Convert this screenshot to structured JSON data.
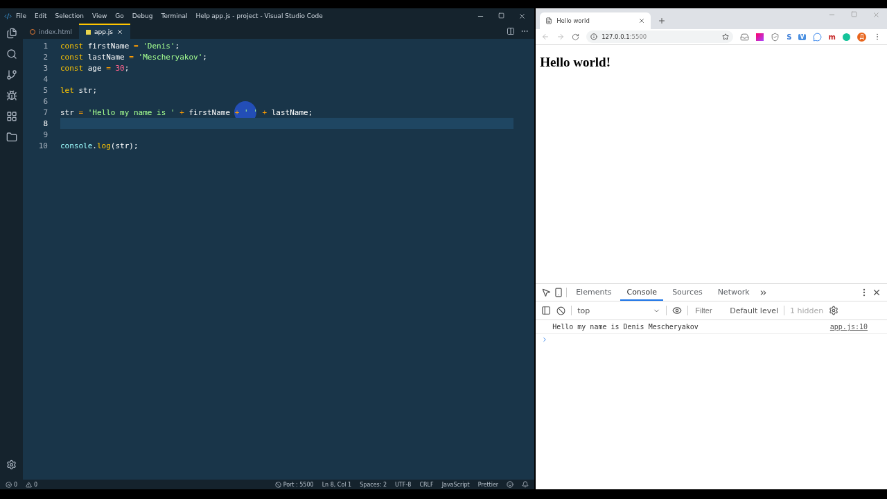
{
  "editor": {
    "window_title": "app.js - project - Visual Studio Code",
    "menu": [
      "File",
      "Edit",
      "Selection",
      "View",
      "Go",
      "Debug",
      "Terminal",
      "Help"
    ],
    "tabs": [
      {
        "label": "index.html",
        "kind": "html",
        "selected": false
      },
      {
        "label": "app.js",
        "kind": "js",
        "selected": true
      }
    ],
    "lines": [
      {
        "number": "1",
        "current": false,
        "tokens": [
          {
            "kind": "keyword",
            "text": "const"
          },
          {
            "kind": "name",
            "text": " firstName "
          },
          {
            "kind": "op",
            "text": "="
          },
          {
            "kind": "string",
            "text": " 'Denis'"
          },
          {
            "kind": "punct",
            "text": ";"
          }
        ]
      },
      {
        "number": "2",
        "current": false,
        "tokens": [
          {
            "kind": "keyword",
            "text": "const"
          },
          {
            "kind": "name",
            "text": " lastName "
          },
          {
            "kind": "op",
            "text": "="
          },
          {
            "kind": "string",
            "text": " 'Mescheryakov'"
          },
          {
            "kind": "punct",
            "text": ";"
          }
        ]
      },
      {
        "number": "3",
        "current": false,
        "tokens": [
          {
            "kind": "keyword",
            "text": "const"
          },
          {
            "kind": "name",
            "text": " age "
          },
          {
            "kind": "op",
            "text": "="
          },
          {
            "kind": "number",
            "text": " 30"
          },
          {
            "kind": "punct",
            "text": ";"
          }
        ]
      },
      {
        "number": "4",
        "current": false
      },
      {
        "number": "5",
        "current": false,
        "tokens": [
          {
            "kind": "keyword",
            "text": "let"
          },
          {
            "kind": "name",
            "text": " str"
          },
          {
            "kind": "punct",
            "text": ";"
          }
        ]
      },
      {
        "number": "6",
        "current": false
      },
      {
        "number": "7",
        "current": false,
        "cursor": true,
        "tokens": [
          {
            "kind": "name",
            "text": "str "
          },
          {
            "kind": "op",
            "text": "="
          },
          {
            "kind": "string",
            "text": " 'Hello my name is ' "
          },
          {
            "kind": "op",
            "text": "+"
          },
          {
            "kind": "name",
            "text": " firstName "
          },
          {
            "kind": "op",
            "text": "+"
          },
          {
            "kind": "string",
            "text": " ' ' "
          },
          {
            "kind": "op",
            "text": "+"
          },
          {
            "kind": "name",
            "text": " lastName"
          },
          {
            "kind": "punct",
            "text": ";"
          }
        ]
      },
      {
        "number": "8",
        "current": true
      },
      {
        "number": "9",
        "current": false
      },
      {
        "number": "10",
        "current": false,
        "tokens": [
          {
            "kind": "object",
            "text": "console"
          },
          {
            "kind": "punct",
            "text": "."
          },
          {
            "kind": "fn",
            "text": "log"
          },
          {
            "kind": "punct",
            "text": "(str);"
          }
        ]
      }
    ],
    "status_left": [
      {
        "kind": "error",
        "text": "0"
      },
      {
        "kind": "warning",
        "text": "0"
      }
    ],
    "status_right": [
      {
        "kind": "port",
        "text": "Port : 5500"
      },
      {
        "kind": "text",
        "text": "Ln 8, Col 1"
      },
      {
        "kind": "text",
        "text": "Spaces: 2"
      },
      {
        "kind": "text",
        "text": "UTF-8"
      },
      {
        "kind": "text",
        "text": "CRLF"
      },
      {
        "kind": "text",
        "text": "JavaScript"
      },
      {
        "kind": "text",
        "text": "Prettier"
      },
      {
        "kind": "smile"
      },
      {
        "kind": "bell"
      }
    ]
  },
  "browser": {
    "tab_title": "Hello world",
    "url_host": "127.0.0.1",
    "url_port": ":5500",
    "extensions": [
      {
        "kind": "pocket"
      },
      {
        "kind": "gradient"
      },
      {
        "kind": "shield"
      },
      {
        "kind": "letter",
        "label": "S",
        "color": "#3b7dd8"
      },
      {
        "kind": "badge",
        "label": "V",
        "color": "#4a8fe0"
      },
      {
        "kind": "chat"
      },
      {
        "kind": "letter",
        "label": "m",
        "color": "#c62828"
      },
      {
        "kind": "grammar"
      }
    ],
    "avatar": "Д",
    "heading": "Hello world!",
    "devtools": {
      "tabs": [
        {
          "label": "Elements",
          "selected": false
        },
        {
          "label": "Console",
          "selected": true
        },
        {
          "label": "Sources",
          "selected": false
        },
        {
          "label": "Network",
          "selected": false
        }
      ],
      "context": "top",
      "filter_placeholder": "Filter",
      "level": "Default level",
      "hidden": "1 hidden",
      "messages": [
        {
          "text": "Hello my name is Denis Mescheryakov",
          "source": "app.js:10"
        }
      ]
    }
  }
}
